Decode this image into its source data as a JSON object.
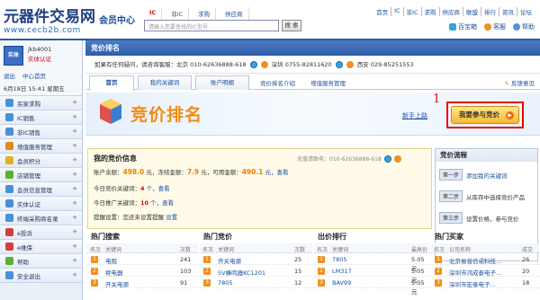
{
  "header": {
    "logo_cn": "元器件交易网",
    "logo_url": "www.cecb2b.com",
    "member_center": "会员中心",
    "search_tabs": [
      "IC",
      "非IC",
      "求购",
      "供应商"
    ],
    "search_placeholder": "请输入您要查找的IC型号",
    "search_button": "搜 索",
    "top_nav": [
      "首页",
      "IC",
      "非IC",
      "求购",
      "供应商",
      "联盟",
      "排行",
      "资讯",
      "论坛"
    ],
    "top_links": [
      "百宝箱",
      "客服",
      "帮助"
    ]
  },
  "sidebar": {
    "avatar_text": "实体",
    "username": "jkb4001",
    "verified": "实体认证",
    "logout": "退出",
    "mycenter": "中心首页",
    "date": "6月18日 15:41 星期五",
    "menu": [
      {
        "label": "买家求购",
        "icon_color": "#4a90d9"
      },
      {
        "label": "IC销售",
        "icon_color": "#4a90d9"
      },
      {
        "label": "非IC销售",
        "icon_color": "#4a90d9"
      },
      {
        "label": "增值服务管理",
        "icon_color": "#e08a20"
      },
      {
        "label": "会员积分",
        "icon_color": "#e0b020"
      },
      {
        "label": "店铺管理",
        "icon_color": "#5ab030"
      },
      {
        "label": "会员信息管理",
        "icon_color": "#4a90d9"
      },
      {
        "label": "实体认证",
        "icon_color": "#4a90d9"
      },
      {
        "label": "终端采购商名录",
        "icon_color": "#4a90d9"
      },
      {
        "label": "e投诉",
        "icon_color": "#d04040"
      },
      {
        "label": "e维保",
        "icon_color": "#d04040"
      },
      {
        "label": "帮助",
        "icon_color": "#5ab030"
      },
      {
        "label": "安全退出",
        "icon_color": "#4a90d9"
      }
    ]
  },
  "main": {
    "panel_title": "竞价排名",
    "hotline_text": "如果有任何疑问，请咨询客服：北京 010-62636888-618",
    "hotline_sz": "深圳 0755-82811620",
    "hotline_xa": "西安 029-85251553",
    "tabs": [
      "首页",
      "我的关键词",
      "账户明细"
    ],
    "plain_tabs": [
      "竞价排名介绍",
      "增值服务管理"
    ],
    "feedback": "反馈意见",
    "banner_title": "竞价排名",
    "newbie_link": "新手上路",
    "join_button": "我要参与竞价",
    "step_marker": "1",
    "info": {
      "title": "我的竞价信息",
      "phone": "充值请致电：010-62636888-618",
      "balance_label": "账户余额：",
      "balance": "498.0",
      "frozen_label": "元，冻结金额：",
      "frozen": "7.9",
      "usable_label": "元，可用金额：",
      "usable": "490.1",
      "yuan": "元，查看",
      "today_label": "今日竞价关键词：",
      "today_count": "4",
      "today_suffix": "个，查看",
      "promote_label": "今日推广关键词：",
      "promote_count": "10",
      "promote_suffix": "个，查看",
      "remind_label": "提醒设置：您还未设置提醒",
      "remind_link": "设置"
    },
    "flow": {
      "title": "竞价流程",
      "steps": [
        {
          "label": "第一步",
          "text": "添加我的关键词"
        },
        {
          "label": "第二步",
          "text": "从库存中选择竞价产品"
        },
        {
          "label": "第三步",
          "text": "设置价格，参与竞价"
        }
      ]
    },
    "lists": [
      {
        "title": "热门搜索",
        "headers": [
          "名次",
          "关键词",
          "次数"
        ],
        "rows": [
          [
            "1",
            "电阻",
            "241"
          ],
          [
            "2",
            "继电器",
            "103"
          ],
          [
            "3",
            "开关电源",
            "91"
          ]
        ]
      },
      {
        "title": "热门竞价",
        "headers": [
          "名次",
          "关键词",
          "次数"
        ],
        "rows": [
          [
            "1",
            "开关电源",
            "25"
          ],
          [
            "2",
            "5V蜂鸣器KC1201",
            "15"
          ],
          [
            "3",
            "7805",
            "12"
          ]
        ]
      },
      {
        "title": "出价排行",
        "headers": [
          "名次",
          "关键词",
          "最高价"
        ],
        "rows": [
          [
            "1",
            "7805",
            "5.05元"
          ],
          [
            "2",
            "LM317",
            "5.05元"
          ],
          [
            "3",
            "BAV99",
            "5.05元"
          ]
        ]
      },
      {
        "title": "热门买家",
        "headers": [
          "名次",
          "公司名称",
          "成交"
        ],
        "rows": [
          [
            "1",
            "北京易普信诺科技...",
            "26"
          ],
          [
            "2",
            "深圳市鸿成泰电子...",
            "20"
          ],
          [
            "3",
            "深圳市宏泰电子...",
            "18"
          ]
        ]
      }
    ]
  }
}
